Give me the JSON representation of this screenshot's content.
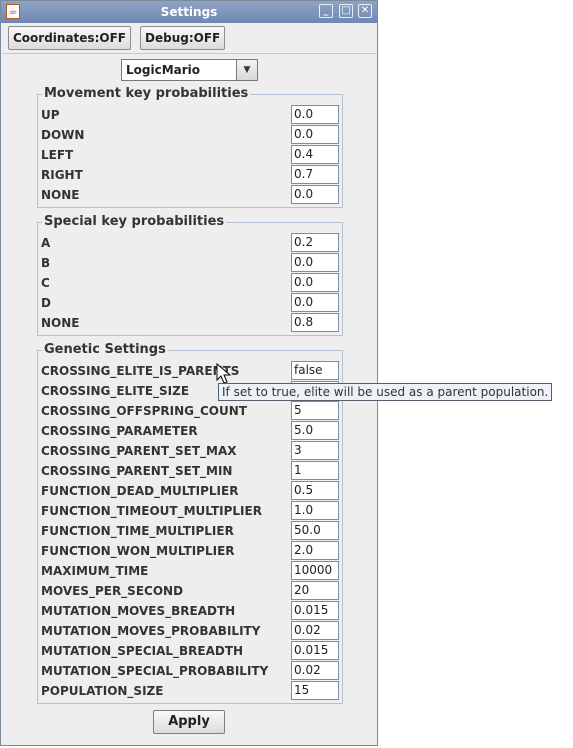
{
  "window": {
    "title": "Settings",
    "icon": "java-cup-icon",
    "controls": {
      "minimize": "minimize-icon",
      "maximize": "maximize-icon",
      "close": "close-icon"
    }
  },
  "toolbar": {
    "coordinates_label": "Coordinates:OFF",
    "debug_label": "Debug:OFF"
  },
  "agent_select": {
    "value": "LogicMario"
  },
  "movement": {
    "title": "Movement key probabilities",
    "rows": [
      {
        "label": "UP",
        "value": "0.0"
      },
      {
        "label": "DOWN",
        "value": "0.0"
      },
      {
        "label": "LEFT",
        "value": "0.4"
      },
      {
        "label": "RIGHT",
        "value": "0.7"
      },
      {
        "label": "NONE",
        "value": "0.0"
      }
    ]
  },
  "special": {
    "title": "Special key probabilities",
    "rows": [
      {
        "label": "A",
        "value": "0.2"
      },
      {
        "label": "B",
        "value": "0.0"
      },
      {
        "label": "C",
        "value": "0.0"
      },
      {
        "label": "D",
        "value": "0.0"
      },
      {
        "label": "NONE",
        "value": "0.8"
      }
    ]
  },
  "genetic": {
    "title": "Genetic Settings",
    "rows": [
      {
        "label": "CROSSING_ELITE_IS_PARENTS",
        "value": "false"
      },
      {
        "label": "CROSSING_ELITE_SIZE",
        "value": ""
      },
      {
        "label": "CROSSING_OFFSPRING_COUNT",
        "value": "5"
      },
      {
        "label": "CROSSING_PARAMETER",
        "value": "5.0"
      },
      {
        "label": "CROSSING_PARENT_SET_MAX",
        "value": "3"
      },
      {
        "label": "CROSSING_PARENT_SET_MIN",
        "value": "1"
      },
      {
        "label": "FUNCTION_DEAD_MULTIPLIER",
        "value": "0.5"
      },
      {
        "label": "FUNCTION_TIMEOUT_MULTIPLIER",
        "value": "1.0"
      },
      {
        "label": "FUNCTION_TIME_MULTIPLIER",
        "value": "50.0"
      },
      {
        "label": "FUNCTION_WON_MULTIPLIER",
        "value": "2.0"
      },
      {
        "label": "MAXIMUM_TIME",
        "value": "10000"
      },
      {
        "label": "MOVES_PER_SECOND",
        "value": "20"
      },
      {
        "label": "MUTATION_MOVES_BREADTH",
        "value": "0.015"
      },
      {
        "label": "MUTATION_MOVES_PROBABILITY",
        "value": "0.02"
      },
      {
        "label": "MUTATION_SPECIAL_BREADTH",
        "value": "0.015"
      },
      {
        "label": "MUTATION_SPECIAL_PROBABILITY",
        "value": "0.02"
      },
      {
        "label": "POPULATION_SIZE",
        "value": "15"
      }
    ]
  },
  "apply_label": "Apply",
  "tooltip": "If set to true, elite will be used as a parent population."
}
